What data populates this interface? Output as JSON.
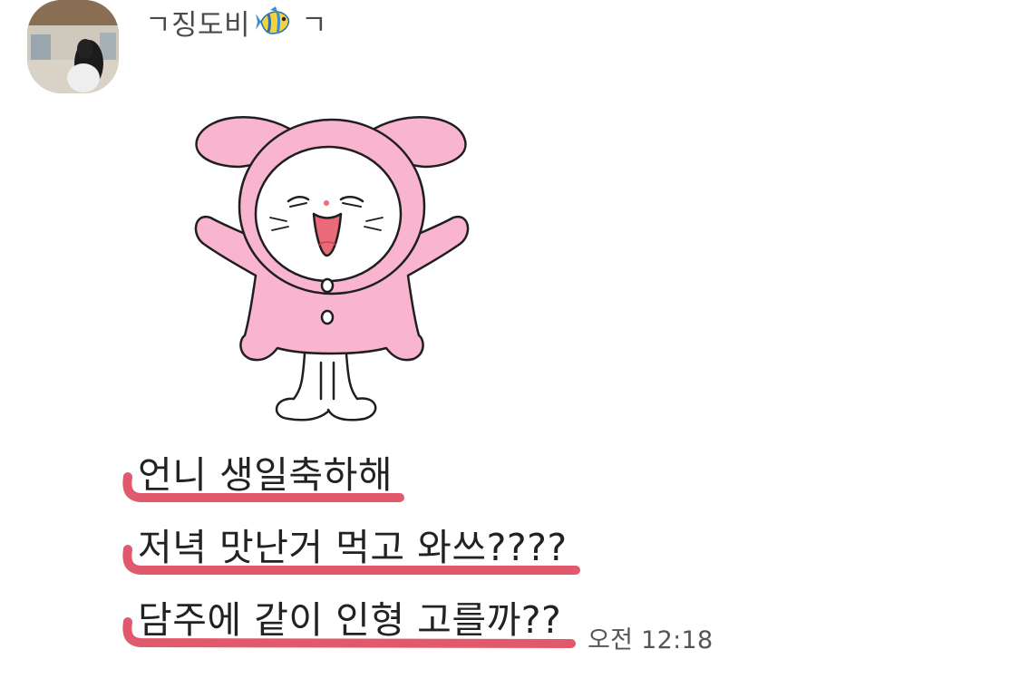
{
  "sender": {
    "name_prefix": "ㄱ징도비",
    "name_suffix": "ㄱ",
    "emoji_icon": "tropical-fish-icon"
  },
  "sticker": {
    "icon": "pink-bunny-costume-character-sticker"
  },
  "messages": [
    {
      "text": "언니 생일축하해"
    },
    {
      "text": "저녁 맛난거 먹고 와쓰????"
    },
    {
      "text": "담주에 같이 인형 고를까??"
    }
  ],
  "timestamp": "오전 12:18",
  "colors": {
    "underline": "#e0596d",
    "sticker_pink": "#f9b4cf",
    "background": "#ffffff"
  }
}
